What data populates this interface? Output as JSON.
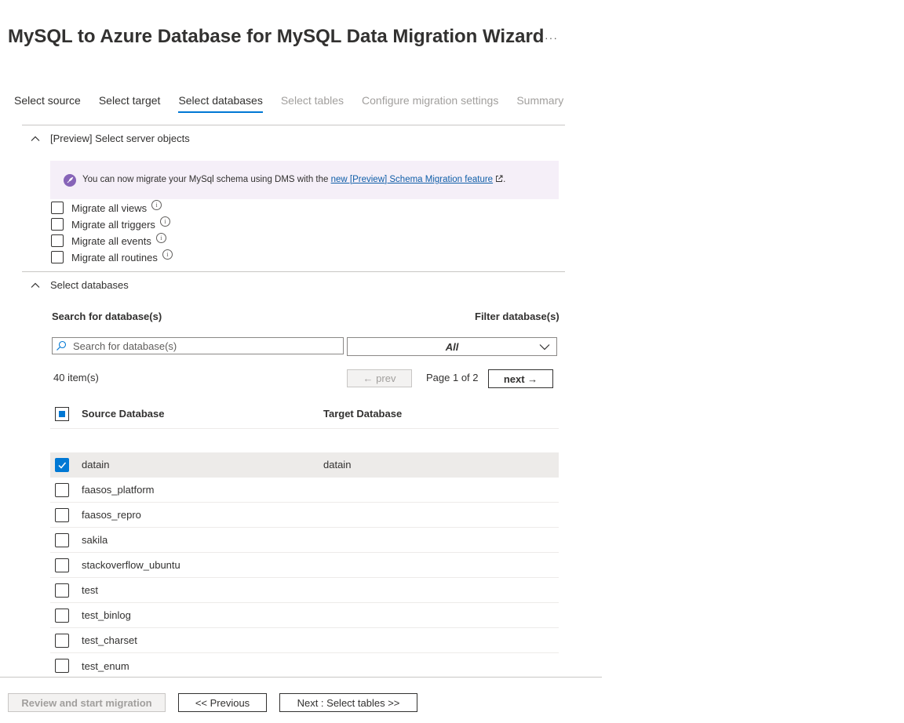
{
  "header": {
    "title": "MySQL to Azure Database for MySQL Data Migration Wizard",
    "more_label": "···"
  },
  "tabs": [
    {
      "label": "Select source",
      "state": "enabled"
    },
    {
      "label": "Select target",
      "state": "enabled"
    },
    {
      "label": "Select databases",
      "state": "active"
    },
    {
      "label": "Select tables",
      "state": "disabled"
    },
    {
      "label": "Configure migration settings",
      "state": "disabled"
    },
    {
      "label": "Summary",
      "state": "disabled"
    }
  ],
  "server_objects": {
    "heading": "[Preview] Select server objects",
    "banner": {
      "text_before": "You can now migrate your MySql schema using DMS with the ",
      "link_text": "new [Preview] Schema Migration feature",
      "text_after": ".",
      "icon": "rocket-icon"
    },
    "options": [
      {
        "label": "Migrate all views",
        "checked": false
      },
      {
        "label": "Migrate all triggers",
        "checked": false
      },
      {
        "label": "Migrate all events",
        "checked": false
      },
      {
        "label": "Migrate all routines",
        "checked": false
      }
    ]
  },
  "databases": {
    "heading": "Select databases",
    "search_label": "Search for database(s)",
    "filter_label": "Filter database(s)",
    "search_placeholder": "Search for database(s)",
    "filter_value": "All",
    "items_count": "40 item(s)",
    "prev_label": "← prev",
    "page_label": "Page 1 of 2",
    "next_label": "next →",
    "columns": {
      "source": "Source Database",
      "target": "Target Database"
    },
    "rows": [
      {
        "source": "datain",
        "target": "datain",
        "checked": true
      },
      {
        "source": "faasos_platform",
        "target": "",
        "checked": false
      },
      {
        "source": "faasos_repro",
        "target": "",
        "checked": false
      },
      {
        "source": "sakila",
        "target": "",
        "checked": false
      },
      {
        "source": "stackoverflow_ubuntu",
        "target": "",
        "checked": false
      },
      {
        "source": "test",
        "target": "",
        "checked": false
      },
      {
        "source": "test_binlog",
        "target": "",
        "checked": false
      },
      {
        "source": "test_charset",
        "target": "",
        "checked": false
      },
      {
        "source": "test_enum",
        "target": "",
        "checked": false
      }
    ]
  },
  "footer": {
    "review_label": "Review and start migration",
    "previous_label": "<< Previous",
    "next_label": "Next : Select tables >>"
  },
  "colors": {
    "accent": "#0078d4",
    "banner_bg": "#f5eff8",
    "banner_icon": "#8764b8",
    "selected_row": "#edebe9"
  }
}
